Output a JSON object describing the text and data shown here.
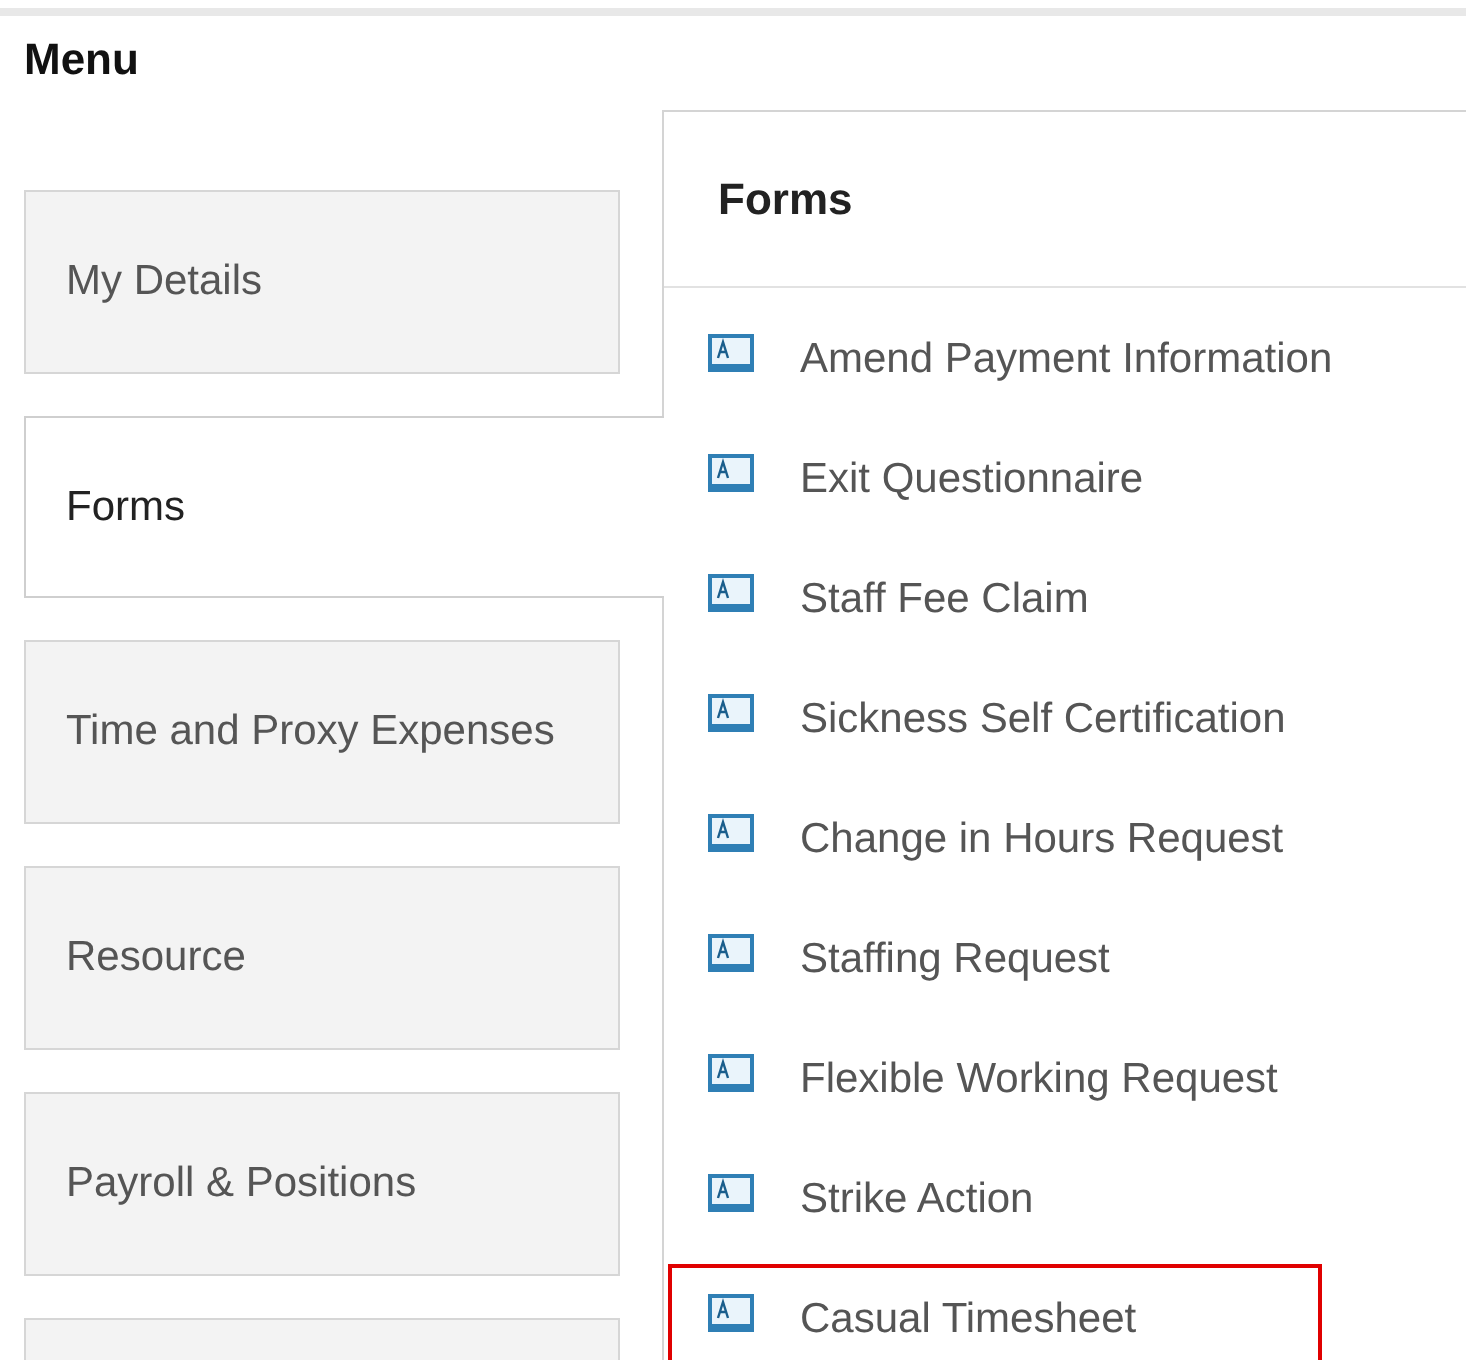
{
  "menu": {
    "title": "Menu",
    "tabs": [
      {
        "label": "My Details",
        "selected": false
      },
      {
        "label": "Forms",
        "selected": true
      },
      {
        "label": "Time and Proxy Expenses",
        "selected": false
      },
      {
        "label": "Resource",
        "selected": false
      },
      {
        "label": "Payroll & Positions",
        "selected": false
      },
      {
        "selected": false
      }
    ]
  },
  "forms_panel": {
    "title": "Forms",
    "items": [
      {
        "label": "Amend Payment Information",
        "highlighted": false
      },
      {
        "label": "Exit Questionnaire",
        "highlighted": false
      },
      {
        "label": "Staff Fee Claim",
        "highlighted": false
      },
      {
        "label": "Sickness Self Certification",
        "highlighted": false
      },
      {
        "label": "Change in Hours Request",
        "highlighted": false
      },
      {
        "label": "Staffing Request",
        "highlighted": false
      },
      {
        "label": "Flexible Working Request",
        "highlighted": false
      },
      {
        "label": "Strike Action",
        "highlighted": false
      },
      {
        "label": "Casual Timesheet",
        "highlighted": true
      }
    ]
  }
}
